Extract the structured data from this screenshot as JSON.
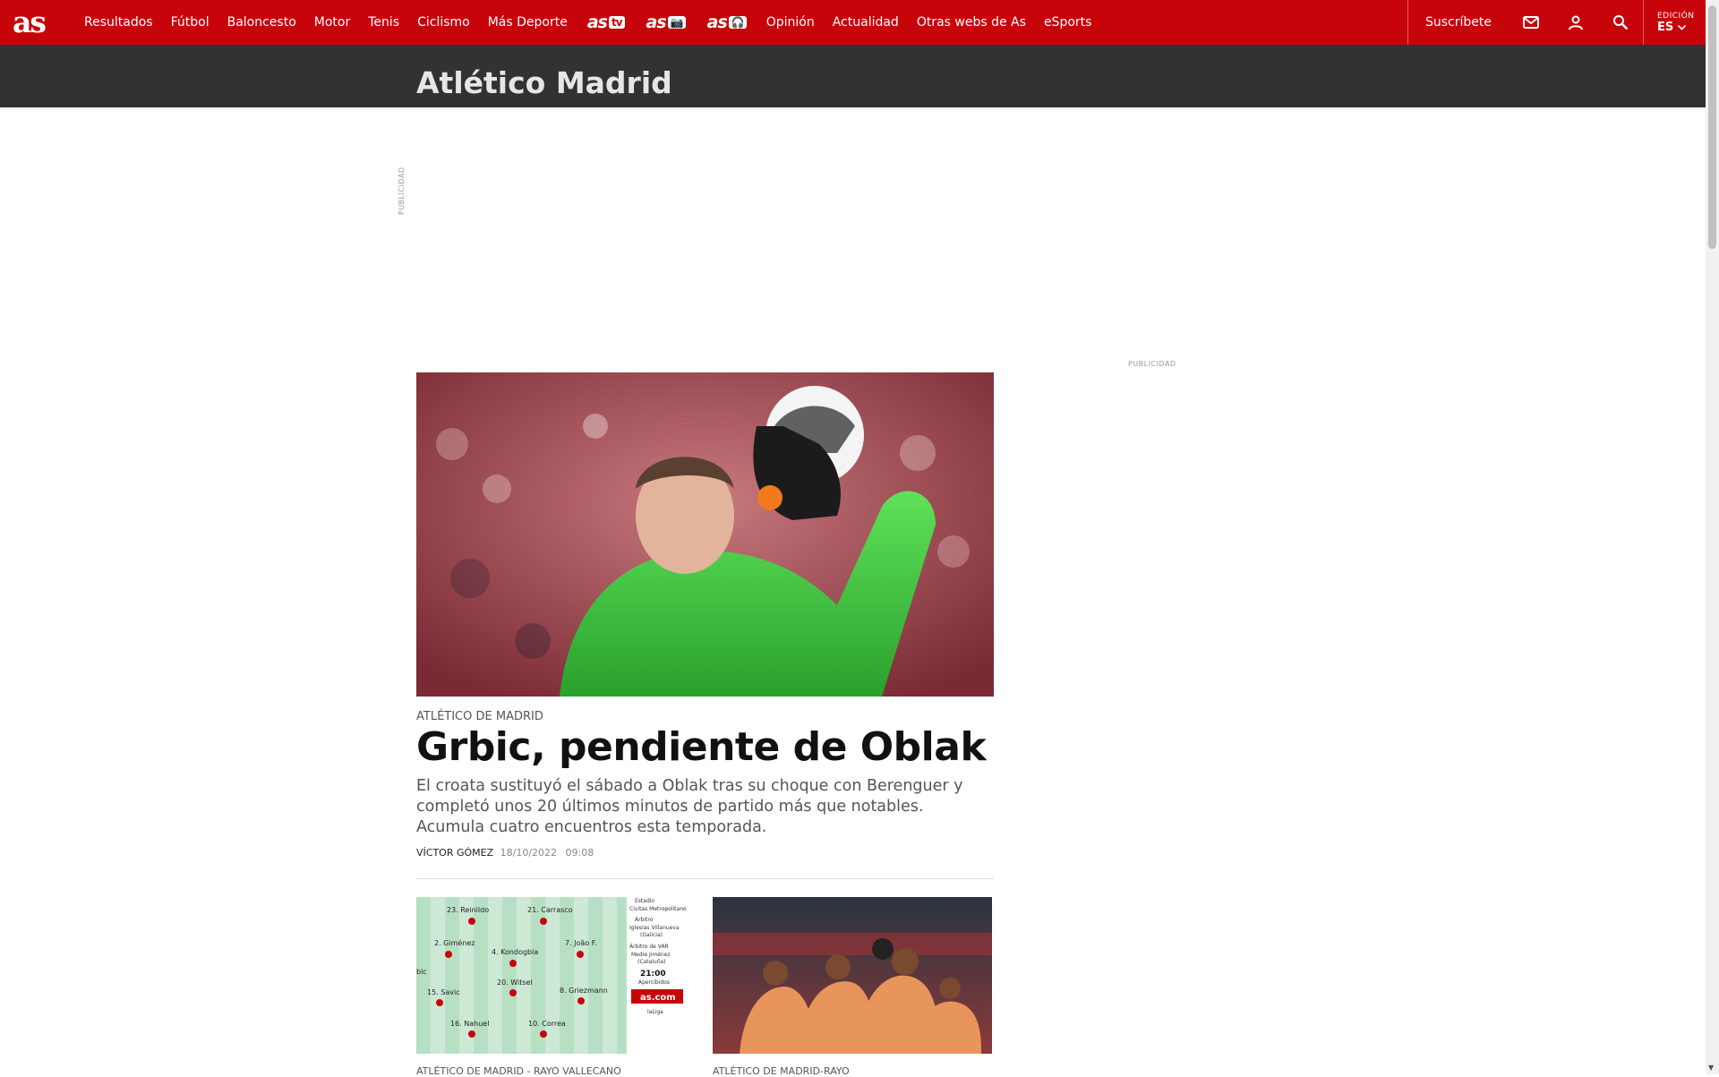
{
  "header": {
    "logo": "as",
    "nav": [
      "Resultados",
      "Fútbol",
      "Baloncesto",
      "Motor",
      "Tenis",
      "Ciclismo",
      "Más Deporte"
    ],
    "brand_logos": [
      {
        "text": "as",
        "badge": "tv"
      },
      {
        "text": "as",
        "badge": "📷"
      },
      {
        "text": "as",
        "badge": "🎧"
      }
    ],
    "nav2": [
      "Opinión",
      "Actualidad",
      "Otras webs de As",
      "eSports"
    ],
    "subscribe": "Suscríbete",
    "edition_label": "EDICIÓN",
    "edition_value": "ES"
  },
  "section": {
    "title": "Atlético Madrid"
  },
  "ads": {
    "label_vertical": "PUBLICIDAD",
    "label_right": "PUBLICIDAD"
  },
  "main_article": {
    "kicker": "ATLÉTICO DE MADRID",
    "headline": "Grbic, pendiente de Oblak",
    "dek": "El croata sustituyó el sábado a Oblak tras su choque con Berenguer y completó unos 20 últimos minutos de partido más que notables. Acumula cuatro encuentros esta temporada.",
    "author": "VÍCTOR GÓMEZ",
    "date": "18/10/2022",
    "time": "09:08"
  },
  "lineup_graphic": {
    "players": [
      "23. Reinildo",
      "21. Carrasco",
      "2. Giménez",
      "4. Kondogbia",
      "7. João F.",
      "20. Witsel",
      "15. Savic",
      "8. Griezmann",
      "16. Nahuel",
      "10. Correa",
      "bic"
    ],
    "info": [
      "Estadio",
      "Civitas Metropolitano",
      "Árbitro",
      "Iglesias Villanueva",
      "(Galicia)",
      "Árbitro de VAR",
      "Medie Jiménez",
      "(Cataluña)",
      "21:00",
      "Apercibidos",
      "as.com",
      "laLiga"
    ]
  },
  "cards": [
    {
      "kicker": "ATLÉTICO DE MADRID - RAYO VALLECANO"
    },
    {
      "kicker": "ATLÉTICO DE MADRID-RAYO"
    }
  ],
  "colors": {
    "brand_red": "#c8040b",
    "section_bar": "#323232"
  }
}
